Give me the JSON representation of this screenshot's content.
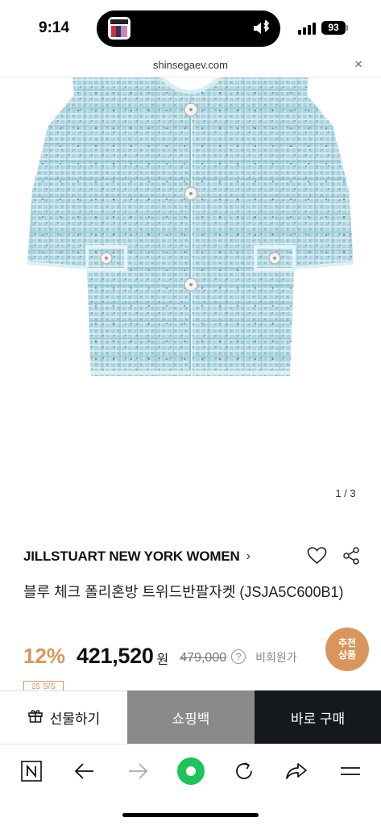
{
  "status_bar": {
    "time": "9:14",
    "battery": "93",
    "icons": [
      "now-playing-icon",
      "bluetooth-icon",
      "signal-icon",
      "battery-icon"
    ]
  },
  "url_bar": {
    "url": "shinsegaev.com",
    "close_label": "×"
  },
  "product_image": {
    "counter": "1 / 3",
    "description_colors": {
      "tweed": "#a9d3e0",
      "background": "#ffffff"
    }
  },
  "product": {
    "brand": "JILLSTUART NEW YORK WOMEN",
    "brand_chevron": "›",
    "name": "블루 체크 폴리혼방 트위드반팔자켓 (JSJA5C600B1)",
    "discount": "12%",
    "price": "421,520",
    "currency": "원",
    "original_price": "479,000",
    "help": "?",
    "member_label": "비회원가",
    "season_tag": "25 S/S"
  },
  "recommend_badge": {
    "line1": "추천",
    "line2": "상품"
  },
  "actions": {
    "gift_label": "선물하기",
    "bag_label": "쇼핑백",
    "buy_label": "바로 구매"
  },
  "browser_toolbar": {
    "icons": [
      "n-icon",
      "back-arrow-icon",
      "forward-arrow-icon",
      "green-dot-icon",
      "refresh-icon",
      "share-icon",
      "menu-icon"
    ]
  },
  "colors": {
    "accent": "#d8965c",
    "buy_button": "#15181d",
    "bag_button": "#8a8a8a",
    "green_dot": "#1ec35a"
  }
}
